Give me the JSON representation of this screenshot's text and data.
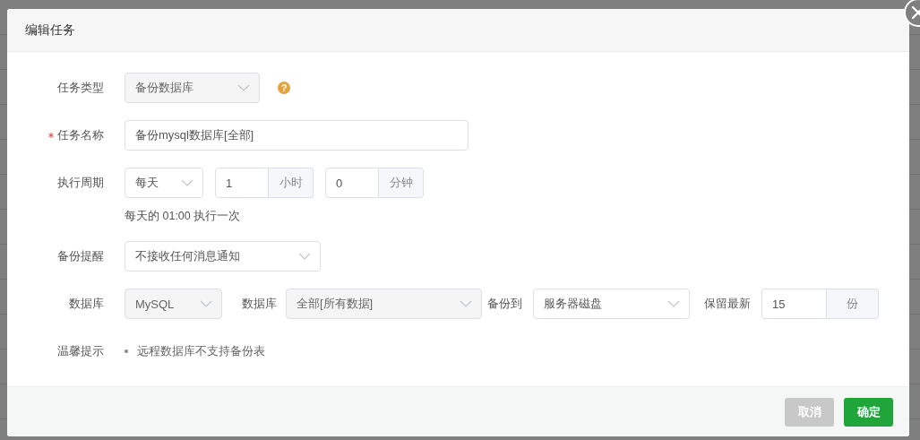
{
  "dialog": {
    "title": "编辑任务",
    "rows": [
      {
        "label": "任务类型",
        "required": false,
        "controls": [
          {
            "kind": "select",
            "value": "备份数据库",
            "disabled": true
          },
          {
            "kind": "help",
            "text": "?"
          }
        ]
      },
      {
        "label": "任务名称",
        "required": true,
        "controls": [
          {
            "kind": "input",
            "value": "备份mysql数据库[全部]"
          }
        ]
      },
      {
        "label": "执行周期",
        "required": false,
        "controls": [
          {
            "kind": "select",
            "value": "每天",
            "disabled": false
          },
          {
            "kind": "addon-input",
            "value": "1",
            "addon": "小时"
          },
          {
            "kind": "addon-input",
            "value": "0",
            "addon": "分钟"
          }
        ],
        "hint": "每天的 01:00 执行一次"
      },
      {
        "label": "备份提醒",
        "required": false,
        "controls": [
          {
            "kind": "select",
            "value": "不接收任何消息通知",
            "disabled": false
          }
        ]
      },
      {
        "label": "数据库",
        "required": false,
        "controls": [
          {
            "kind": "select",
            "value": "MySQL",
            "disabled": true
          },
          {
            "kind": "label",
            "text": "数据库"
          },
          {
            "kind": "select",
            "value": "全部[所有数据]",
            "disabled": true
          },
          {
            "kind": "label",
            "text": "备份到"
          },
          {
            "kind": "select",
            "value": "服务器磁盘",
            "disabled": false
          },
          {
            "kind": "label",
            "text": "保留最新"
          },
          {
            "kind": "addon-input",
            "value": "15",
            "addon": "份"
          }
        ]
      },
      {
        "label": "温馨提示",
        "required": false,
        "controls": [
          {
            "kind": "bullets",
            "items": [
              "远程数据库不支持备份表"
            ]
          }
        ]
      }
    ],
    "buttons": [
      {
        "label": "取消",
        "kind": "cancel"
      },
      {
        "label": "确定",
        "kind": "primary"
      }
    ]
  }
}
